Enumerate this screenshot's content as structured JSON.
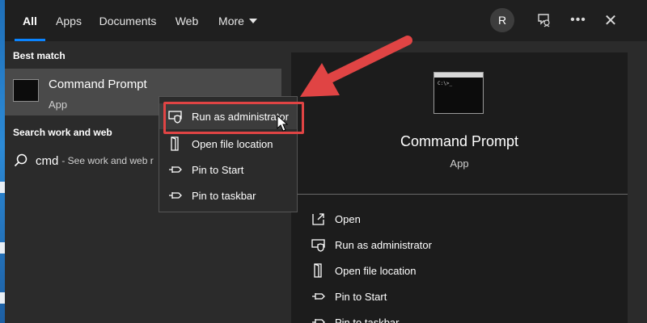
{
  "colors": {
    "accent": "#0a84ff",
    "annotation_red": "#e04444",
    "panel_bg": "#2b2b2b",
    "topbar_bg": "#1f1f1f",
    "detail_bg": "#1c1c1c",
    "selected_bg": "#4a4a4a"
  },
  "tabs": [
    {
      "label": "All",
      "active": true
    },
    {
      "label": "Apps"
    },
    {
      "label": "Documents"
    },
    {
      "label": "Web"
    },
    {
      "label": "More",
      "icon": "chevron-down-icon"
    }
  ],
  "header": {
    "avatar_initial": "R",
    "icons": [
      "feedback-icon",
      "more-options-icon",
      "close-icon"
    ]
  },
  "best_match": {
    "section_label": "Best match",
    "title": "Command Prompt",
    "subtitle": "App",
    "icon": "command-prompt-icon"
  },
  "search_web": {
    "section_label": "Search work and web",
    "query": "cmd",
    "hint": "- See work and web r",
    "icon": "search-icon"
  },
  "context_menu": {
    "items": [
      {
        "label": "Run as administrator",
        "icon": "shield-icon",
        "highlighted": true
      },
      {
        "label": "Open file location",
        "icon": "folder-icon"
      },
      {
        "label": "Pin to Start",
        "icon": "pin-icon"
      },
      {
        "label": "Pin to taskbar",
        "icon": "pin-icon"
      }
    ]
  },
  "details": {
    "title": "Command Prompt",
    "subtitle": "App",
    "actions": [
      {
        "label": "Open",
        "icon": "open-icon"
      },
      {
        "label": "Run as administrator",
        "icon": "shield-icon"
      },
      {
        "label": "Open file location",
        "icon": "folder-icon"
      },
      {
        "label": "Pin to Start",
        "icon": "pin-icon"
      },
      {
        "label": "Pin to taskbar",
        "icon": "pin-icon"
      }
    ]
  }
}
